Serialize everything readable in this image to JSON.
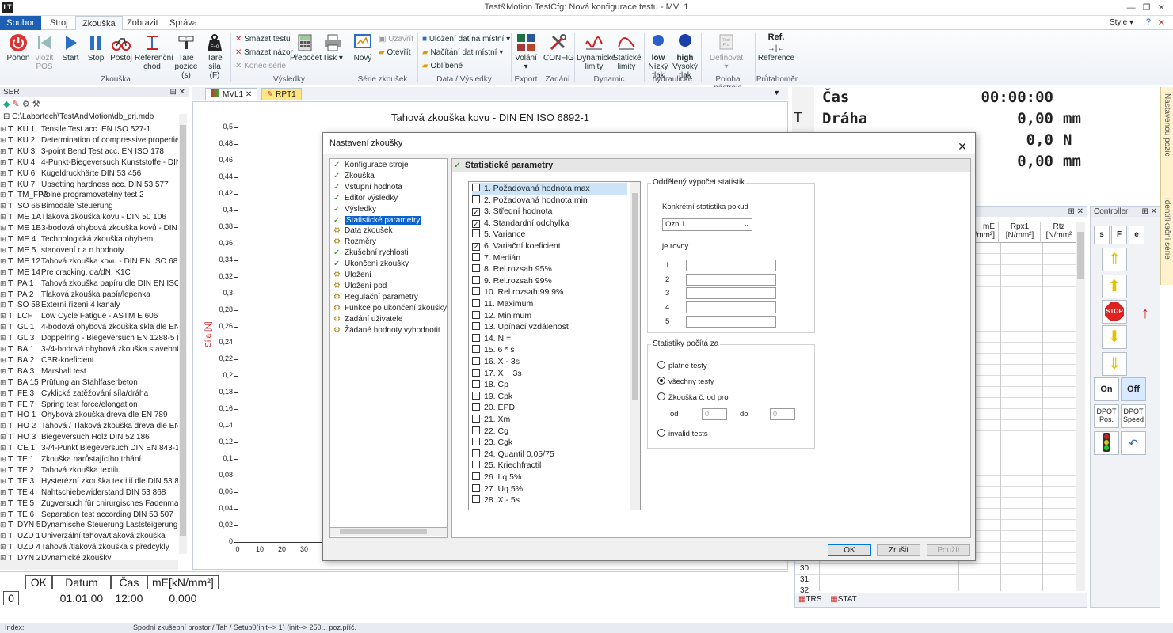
{
  "titlebar": {
    "title": "Test&Motion   TestCfg: Nová konfigurace testu -  MVL1",
    "style_label": "Style",
    "logo": "LT"
  },
  "ribbon_tabs": [
    "Soubor",
    "Stroj",
    "Zkouška",
    "Zobrazit",
    "Správa"
  ],
  "ribbon": {
    "buttons": [
      {
        "label": "Pohon",
        "icon": "power-icon"
      },
      {
        "label": "vložit POS",
        "icon": "skip-back-icon"
      },
      {
        "label": "Start",
        "icon": "play-icon"
      },
      {
        "label": "Stop",
        "icon": "pause-icon"
      },
      {
        "label": "Postoj",
        "icon": "bike-icon"
      },
      {
        "label": "Referenční chod",
        "icon": "reference-icon"
      },
      {
        "label": "Tare pozice (s)",
        "icon": "tare-position-icon"
      },
      {
        "label": "Tare síla (F)",
        "icon": "weight-icon"
      }
    ],
    "group_zkouska": "Zkouška",
    "smazat_testu": "Smazat testu",
    "smazat_nazor": "Smazat názor",
    "konec_serie": "Konec série",
    "prepocet": "Přepočet",
    "tisk": "Tisk",
    "group_vysledky": "Výsledky",
    "novy": "Nový",
    "uzavrit": "Uzavřít",
    "otevrit": "Otevřít",
    "group_serie": "Série zkoušek",
    "ulozeni_dat": "Uložení dat na místní",
    "nacitani_dat": "Načítání dat místní",
    "oblibene": "Oblíbené",
    "group_data": "Data / Výsledky",
    "volani": "Volání",
    "config": "CONFIG",
    "group_export": "Export",
    "group_zadani": "Zadání",
    "dyn_limity": "Dynamické limity",
    "stat_limity": "Statické limity",
    "group_dynamic": "Dynamic",
    "nizky": "Nízký tlak",
    "vysoky": "Vysoký tlak",
    "low": "low",
    "high": "high",
    "group_hydraulicke": "hydraulické",
    "definovat": "Definovat",
    "group_poloha": "Poloha nástroje",
    "reference": "Reference",
    "ref_label": "Ref.",
    "group_prutahomer": "Průtahoměr"
  },
  "left_panel": {
    "title": "SER",
    "db_path": "C:\\Labortech\\TestAndMotion\\db_prj.mdb",
    "items": [
      {
        "code": "KU 1",
        "name": "Tensile Test acc. EN ISO 527-1"
      },
      {
        "code": "KU 2",
        "name": "Determination of compressive propertie"
      },
      {
        "code": "KU 3",
        "name": "3-point Bend Test acc. EN ISO 178"
      },
      {
        "code": "KU 4",
        "name": "4-Punkt-Biegeversuch Kunststoffe - DIN"
      },
      {
        "code": "KU 6",
        "name": "Kugeldruckhärte DIN 53 456"
      },
      {
        "code": "KU 7",
        "name": "Upsetting hardness acc. DIN 53 577"
      },
      {
        "code": "TM_FP2",
        "name": "Volné programovatelný test 2"
      },
      {
        "code": "SO 66",
        "name": "Bimodale Steuerung"
      },
      {
        "code": "ME 1A",
        "name": "Tlaková zkouška kovu - DIN 50 106"
      },
      {
        "code": "ME 1B",
        "name": "3-bodová ohybová zkouška kovů - DIN"
      },
      {
        "code": "ME 4",
        "name": "Technologická zkouška ohybem"
      },
      {
        "code": "ME 5",
        "name": "stanovení r a n hodnoty"
      },
      {
        "code": "ME 12",
        "name": "Tahová zkouška kovu - DIN EN ISO 6892"
      },
      {
        "code": "ME 14",
        "name": "Pre cracking, da/dN, K1C"
      },
      {
        "code": "PA 1",
        "name": "Tahová zkouška papíru dle DIN EN ISO 1"
      },
      {
        "code": "PA 2",
        "name": "Tlaková zkouška papír/lepenka"
      },
      {
        "code": "SO 58",
        "name": "Externí řízení 4 kanály"
      },
      {
        "code": "LCF",
        "name": "Low Cycle Fatigue - ASTM E 606"
      },
      {
        "code": "GL 1",
        "name": "4-bodová ohybová zkouška skla dle  EN"
      },
      {
        "code": "GL 3",
        "name": "Doppelring - Biegeversuch EN 1288-5 (D"
      },
      {
        "code": "BA 1",
        "name": "3-/4-bodová ohybová zkouška stavební"
      },
      {
        "code": "BA 2",
        "name": "CBR-koeficient"
      },
      {
        "code": "BA 3",
        "name": "Marshall test"
      },
      {
        "code": "BA 15",
        "name": "Prüfung an Stahlfaserbeton"
      },
      {
        "code": "FE 3",
        "name": "Cyklické zatěžování síla/dráha"
      },
      {
        "code": "FE 7",
        "name": "Spring test force/elongation"
      },
      {
        "code": "HO 1",
        "name": "Ohybová zkouška dreva dle EN 789"
      },
      {
        "code": "HO 2",
        "name": "Tahová / Tlaková zkouška dreva dle EN"
      },
      {
        "code": "HO 3",
        "name": "Biegeversuch Holz  DIN 52 186"
      },
      {
        "code": "CE 1",
        "name": "3-/4-Punkt Biegeversuch DIN EN 843-1,"
      },
      {
        "code": "TE 1",
        "name": "Zkouška narůstajícího trhání"
      },
      {
        "code": "TE 2",
        "name": "Tahová zkouška textilu"
      },
      {
        "code": "TE 3",
        "name": "Hysterézní zkouška textilií dle DIN 53 835"
      },
      {
        "code": "TE 4",
        "name": "Nahtschiebewiderstand DIN 53 868"
      },
      {
        "code": "TE 5",
        "name": "Zugversuch für chirurgisches Fadenmate"
      },
      {
        "code": "TE 6",
        "name": "Separation test according DIN 53 507"
      },
      {
        "code": "DYN 5",
        "name": "Dynamische Steuerung Laststeigerung"
      },
      {
        "code": "UZD 1",
        "name": "Univerzální tahová/tlaková zkouška"
      },
      {
        "code": "UZD 4",
        "name": "Tahová /tlaková zkouška s předcykly"
      },
      {
        "code": "DYN 2",
        "name": "Dynamické zkoušky"
      }
    ]
  },
  "doc_tabs": [
    "MVL1",
    "RPT1"
  ],
  "chart_data": {
    "type": "line",
    "title": "Tahová zkouška kovu - DIN EN ISO 6892-1",
    "ylabel": "Síla [N]",
    "xlabel": "",
    "yticks": [
      "0,5",
      "0,48",
      "0,46",
      "0,44",
      "0,42",
      "0,4",
      "0,38",
      "0,36",
      "0,34",
      "0,32",
      "0,3",
      "0,28",
      "0,26",
      "0,24",
      "0,22",
      "0,2",
      "0,18",
      "0,16",
      "0,14",
      "0,12",
      "0,1",
      "0,08",
      "0,06",
      "0,04",
      "0,02",
      "0"
    ],
    "xticks": [
      "0",
      "10",
      "20",
      "30"
    ],
    "ylim": [
      0,
      0.5
    ],
    "series": []
  },
  "right_info": {
    "rows": [
      {
        "label": "Čas",
        "value": "00:00:00",
        "unit": ""
      },
      {
        "label": "Dráha",
        "value": "0,00",
        "unit": "mm"
      },
      {
        "label": "",
        "value": "0,0",
        "unit": "N"
      },
      {
        "label": "",
        "value": "0,00",
        "unit": "mm"
      }
    ],
    "t_marker": "T"
  },
  "grid": {
    "headers": [
      "mE [N/mm²]",
      "Rpx1 [N/mm²]",
      "Rtz [N/mm²"
    ],
    "row_numbers": [
      "30",
      "31",
      "32"
    ],
    "tabs": [
      "TRS",
      "STAT"
    ]
  },
  "controller": {
    "title": "Controller",
    "top": [
      "s",
      "F",
      "e"
    ],
    "stop": "STOP",
    "on": "On",
    "off": "Off",
    "dpot_pos": "DPOT Pos.",
    "dpot_speed": "DPOT Speed"
  },
  "side_tabs": [
    "Nastavenou pozici",
    "Identifikační série"
  ],
  "bottom_table": {
    "headers": [
      "OK",
      "Datum",
      "Čas",
      "mE[kN/mm²]"
    ],
    "row": [
      "0",
      "01.01.00",
      "12:00",
      "0,000"
    ]
  },
  "statusbar": {
    "label": "Index:",
    "text": "Spodní zkušební prostor / Tah / Setup0(init--> 1)  (init--> 250...      poz.příč."
  },
  "dialog": {
    "title": "Nastavení zkoušky",
    "nav": [
      {
        "label": "Konfigurace stroje",
        "icon": "check-icon"
      },
      {
        "label": "Zkouška",
        "icon": "check-icon"
      },
      {
        "label": "Vstupní hodnota",
        "icon": "check-icon"
      },
      {
        "label": "Editor výsledky",
        "icon": "check-icon"
      },
      {
        "label": "Výsledky",
        "icon": "check-icon"
      },
      {
        "label": "Statistické parametry",
        "icon": "check-icon"
      },
      {
        "label": "Data zkoušek",
        "icon": "settings-icon"
      },
      {
        "label": "Rozměry",
        "icon": "settings-icon"
      },
      {
        "label": "Zkušební rychlosti",
        "icon": "check-icon"
      },
      {
        "label": "Ukončení zkoušky",
        "icon": "check-icon"
      },
      {
        "label": "Uložení",
        "icon": "settings-icon"
      },
      {
        "label": "Uložení pod",
        "icon": "settings-icon"
      },
      {
        "label": "Regulační parametry",
        "icon": "settings-icon"
      },
      {
        "label": "Funkce po ukončení zkoušky",
        "icon": "settings-icon"
      },
      {
        "label": "Zadání uživatele",
        "icon": "settings-icon"
      },
      {
        "label": "Žádané hodnoty vyhodnotit",
        "icon": "settings-icon"
      }
    ],
    "section_title": "Statistické parametry",
    "stats": [
      {
        "label": "1. Požadovaná hodnota max",
        "checked": false
      },
      {
        "label": "2. Požadovaná hodnota min",
        "checked": false
      },
      {
        "label": "3. Střední hodnota",
        "checked": true
      },
      {
        "label": "4. Standardní odchylka",
        "checked": true
      },
      {
        "label": "5. Variance",
        "checked": false
      },
      {
        "label": "6. Variační koeficient",
        "checked": true
      },
      {
        "label": "7. Medián",
        "checked": false
      },
      {
        "label": "8. Rel.rozsah 95%",
        "checked": false
      },
      {
        "label": "9. Rel.rozsah 99%",
        "checked": false
      },
      {
        "label": "10. Rel.rozsah 99.9%",
        "checked": false
      },
      {
        "label": "11. Maximum",
        "checked": false
      },
      {
        "label": "12. Minimum",
        "checked": false
      },
      {
        "label": "13. Upínací vzdálenost",
        "checked": false
      },
      {
        "label": "14. N =",
        "checked": false
      },
      {
        "label": "15. 6 * s",
        "checked": false
      },
      {
        "label": "16. X - 3s",
        "checked": false
      },
      {
        "label": "17. X + 3s",
        "checked": false
      },
      {
        "label": "18. Cp",
        "checked": false
      },
      {
        "label": "19. Cpk",
        "checked": false
      },
      {
        "label": "20. EPD",
        "checked": false
      },
      {
        "label": "21. Xm",
        "checked": false
      },
      {
        "label": "22. Cg",
        "checked": false
      },
      {
        "label": "23. Cgk",
        "checked": false
      },
      {
        "label": "24. Quantil 0,05/75",
        "checked": false
      },
      {
        "label": "25. Kriechfractil",
        "checked": false
      },
      {
        "label": "26. Lq 5%",
        "checked": false
      },
      {
        "label": "27. Uq 5%",
        "checked": false
      },
      {
        "label": "28. X - 5s",
        "checked": false
      }
    ],
    "separate_title": "Oddělený výpočet statistik",
    "specific_label": "Konkrétní statistika pokud",
    "dropdown_value": "Ozn.1",
    "equals_label": "je rovný",
    "field_nums": [
      "1",
      "2",
      "3",
      "4",
      "5"
    ],
    "computed_title": "Statistiky počítá za",
    "radio_valid": "platné testy",
    "radio_all": "všechny testy",
    "radio_range": "Zkouška č. od pro",
    "from_label": "od",
    "to_label": "do",
    "from_value": "0",
    "to_value": "0",
    "radio_invalid": "invalid tests",
    "ok": "OK",
    "cancel": "Zrušit",
    "apply": "Použít"
  }
}
